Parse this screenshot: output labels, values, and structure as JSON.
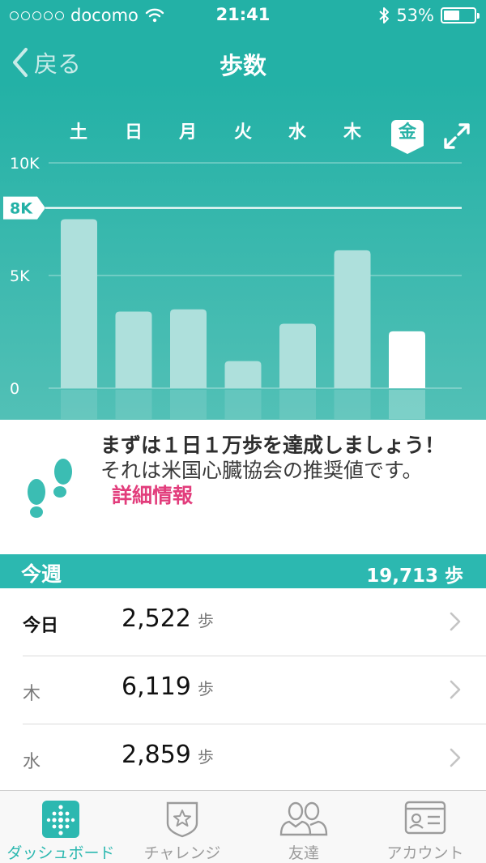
{
  "status_bar": {
    "carrier": "docomo",
    "time": "21:41",
    "battery": "53%",
    "battery_level": 0.53
  },
  "nav": {
    "back_label": "戻る",
    "title": "歩数"
  },
  "chart_data": {
    "type": "bar",
    "categories": [
      "土",
      "日",
      "月",
      "火",
      "水",
      "木",
      "金"
    ],
    "values": [
      7500,
      3400,
      3500,
      1200,
      2859,
      6119,
      2522
    ],
    "selected_index": 6,
    "yticks": [
      "10K",
      "5K",
      "0"
    ],
    "ytick_values": [
      10000,
      5000,
      0
    ],
    "ylim": [
      0,
      10000
    ],
    "goal": {
      "label": "8K",
      "value": 8000
    },
    "grid": true
  },
  "tip": {
    "headline": "まずは１日１万歩を達成しましょう！",
    "body": "それは米国心臓協会の推奨値です。",
    "link": "詳細情報"
  },
  "week": {
    "label": "今週",
    "total": "19,713 歩"
  },
  "rows": [
    {
      "day": "今日",
      "value": "2,522",
      "unit": "歩"
    },
    {
      "day": "木",
      "value": "6,119",
      "unit": "歩"
    },
    {
      "day": "水",
      "value": "2,859",
      "unit": "歩"
    }
  ],
  "tabs": [
    {
      "label": "ダッシュボード",
      "icon": "dashboard-icon"
    },
    {
      "label": "チャレンジ",
      "icon": "challenge-badge-icon"
    },
    {
      "label": "友達",
      "icon": "friends-icon"
    },
    {
      "label": "アカウント",
      "icon": "account-card-icon"
    }
  ],
  "colors": {
    "accent": "#2cb8b0",
    "link": "#e23d7c",
    "bar": "#aee0dc",
    "bar_selected": "#ffffff"
  }
}
